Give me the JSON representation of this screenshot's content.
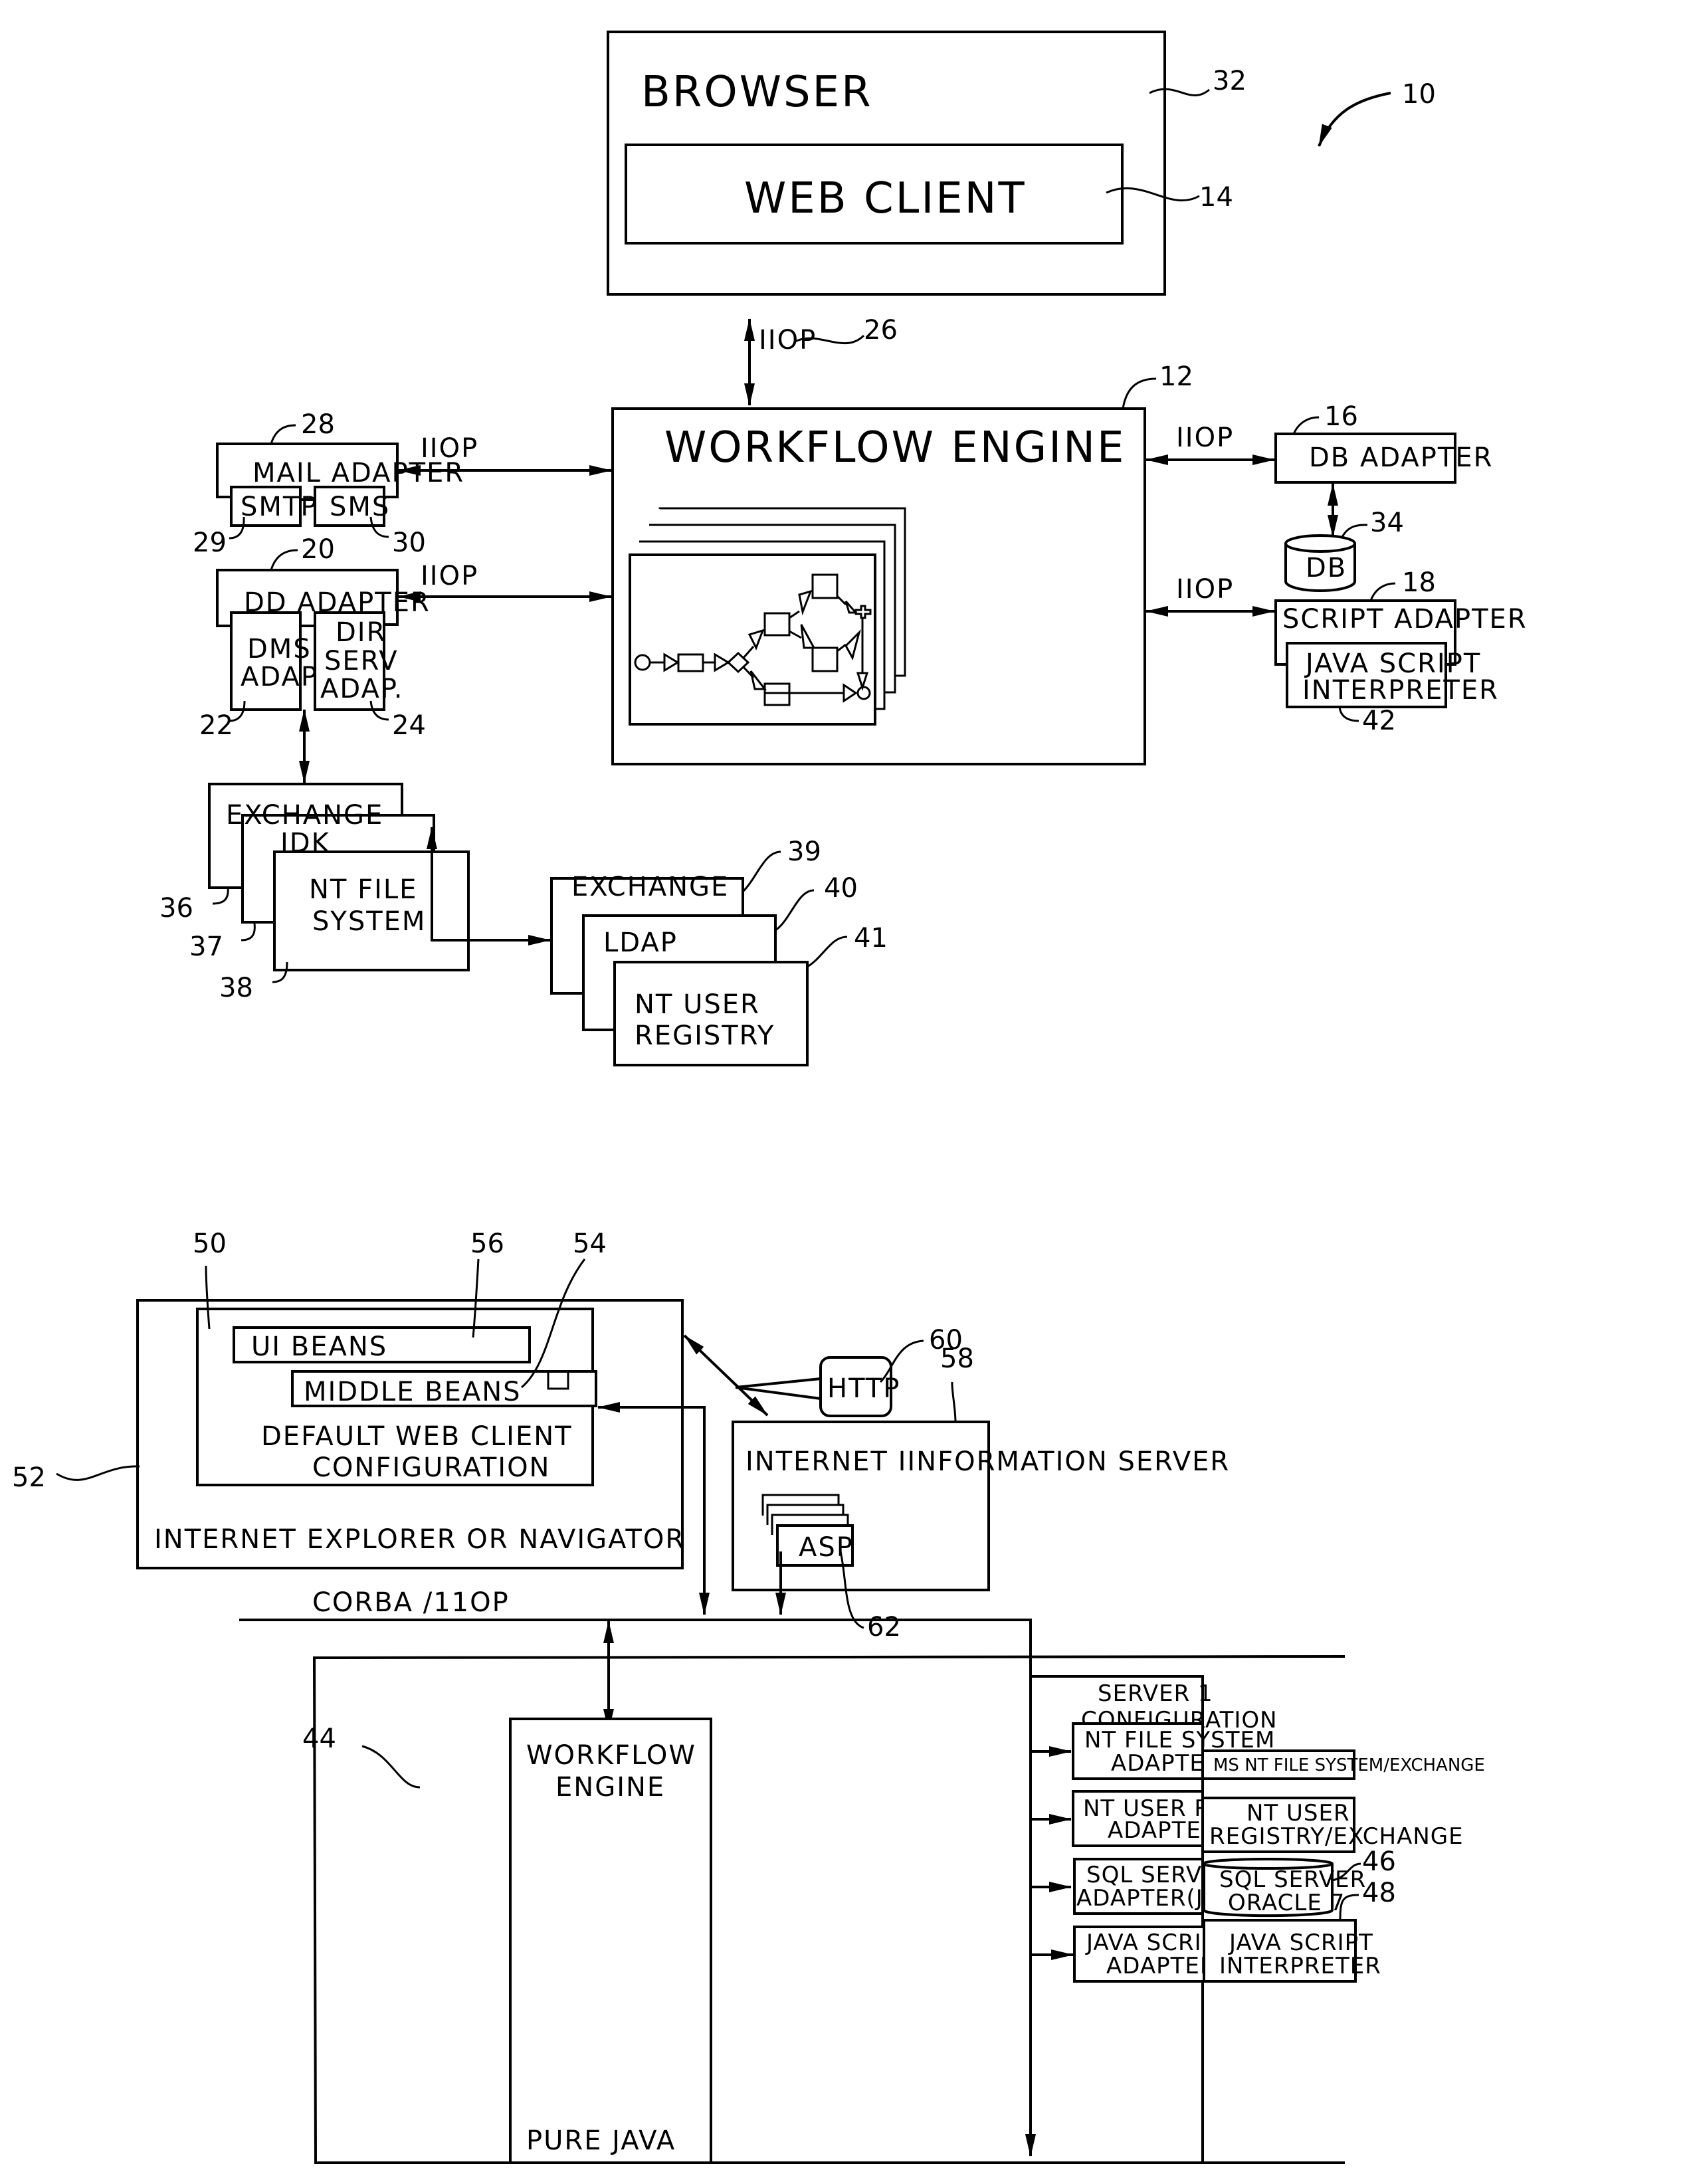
{
  "figure": {
    "top": {
      "ref_system": "10",
      "browser": {
        "label": "BROWSER",
        "ref": "32"
      },
      "web_client": {
        "label": "WEB CLIENT",
        "ref": "14"
      },
      "iiop_main": {
        "label": "IIOP",
        "ref": "26"
      },
      "workflow_engine": {
        "label": "WORKFLOW ENGINE",
        "ref": "12"
      },
      "mail_adapter": {
        "label": "MAIL ADAPTER",
        "ref": "28",
        "iiop": "IIOP",
        "smtp": {
          "label": "SMTP",
          "ref": "29"
        },
        "sms": {
          "label": "SMS",
          "ref": "30"
        }
      },
      "dd_adapter": {
        "label": "DD ADAPTER",
        "ref": "20",
        "iiop": "IIOP",
        "dms": {
          "line1": "DMS",
          "line2": "ADAP.",
          "ref": "22"
        },
        "dir": {
          "line1": "DIR",
          "line2": "SERV",
          "line3": "ADAP.",
          "ref": "24"
        }
      },
      "db_adapter": {
        "label": "DB ADAPTER",
        "ref": "16",
        "iiop": "IIOP"
      },
      "db": {
        "label": "DB",
        "ref": "34"
      },
      "script_adapter": {
        "label": "SCRIPT ADAPTER",
        "ref": "18",
        "iiop": "IIOP",
        "interpreter": {
          "line1": "JAVA SCRIPT",
          "line2": "INTERPRETER",
          "ref": "42"
        }
      },
      "dms_stack": [
        {
          "label": "EXCHANGE",
          "ref": "36"
        },
        {
          "label": "JDK",
          "ref": "37"
        },
        {
          "line1": "NT FILE",
          "line2": "SYSTEM",
          "ref": "38"
        }
      ],
      "dir_stack": [
        {
          "label": "EXCHANGE",
          "ref": "39"
        },
        {
          "label": "LDAP",
          "ref": "40"
        },
        {
          "line1": "NT USER",
          "line2": "REGISTRY",
          "ref": "41"
        }
      ]
    },
    "bottom": {
      "client_box": {
        "label": "INTERNET EXPLORER OR NAVIGATOR",
        "ref": "52"
      },
      "web_client_config": {
        "line1": "DEFAULT WEB CLIENT",
        "line2": "CONFIGURATION",
        "ref": "50"
      },
      "ui_beans": {
        "label": "UI BEANS",
        "ref": "56"
      },
      "middle_beans": {
        "label": "MIDDLE BEANS",
        "ref": "54"
      },
      "http": {
        "label": "HTTP",
        "ref": "60"
      },
      "iis": {
        "label": "INTERNET IINFORMATION SERVER",
        "ref": "58"
      },
      "asp": {
        "label": "ASP",
        "ref": "62"
      },
      "bus": {
        "label": "CORBA /11OP"
      },
      "server": {
        "ref": "44",
        "engine": {
          "line1": "WORKFLOW",
          "line2": "ENGINE",
          "footer": "PURE JAVA"
        },
        "config": {
          "line1": "SERVER 1",
          "line2": "CONFIGURATION"
        },
        "adapters": [
          {
            "line1": "NT FILE SYSTEM",
            "line2": "ADAPTER",
            "target1": "MS NT FILE SYSTEM/EXCHANGE",
            "target2": ""
          },
          {
            "line1": "NT USER REG",
            "line2": "ADAPTER",
            "target1": "NT USER",
            "target2": "REGISTRY/EXCHANGE"
          },
          {
            "line1": "SQL SERVER",
            "line2": "ADAPTER(JDBC)",
            "target1": "SQL SERVER",
            "target2": "ORACLE 7",
            "target_ref": "46"
          },
          {
            "line1": "JAVA SCRIPT",
            "line2": "ADAPTER",
            "target1": "JAVA SCRIPT",
            "target2": "INTERPRETER",
            "target_ref": "48"
          }
        ]
      }
    }
  }
}
